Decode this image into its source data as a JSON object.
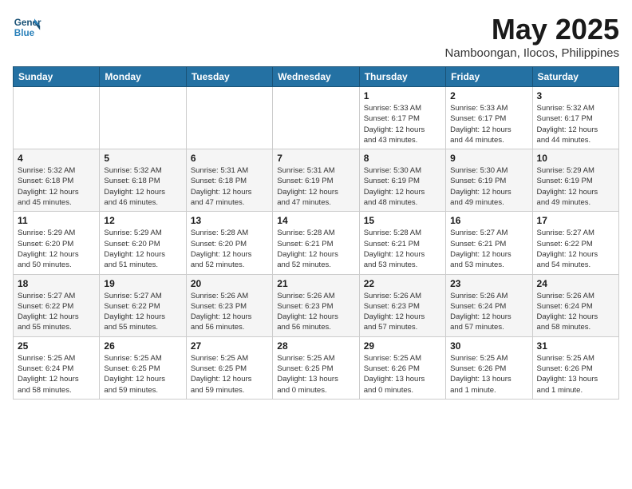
{
  "header": {
    "logo_line1": "General",
    "logo_line2": "Blue",
    "month": "May 2025",
    "location": "Namboongan, Ilocos, Philippines"
  },
  "weekdays": [
    "Sunday",
    "Monday",
    "Tuesday",
    "Wednesday",
    "Thursday",
    "Friday",
    "Saturday"
  ],
  "weeks": [
    [
      {
        "day": "",
        "info": ""
      },
      {
        "day": "",
        "info": ""
      },
      {
        "day": "",
        "info": ""
      },
      {
        "day": "",
        "info": ""
      },
      {
        "day": "1",
        "info": "Sunrise: 5:33 AM\nSunset: 6:17 PM\nDaylight: 12 hours\nand 43 minutes."
      },
      {
        "day": "2",
        "info": "Sunrise: 5:33 AM\nSunset: 6:17 PM\nDaylight: 12 hours\nand 44 minutes."
      },
      {
        "day": "3",
        "info": "Sunrise: 5:32 AM\nSunset: 6:17 PM\nDaylight: 12 hours\nand 44 minutes."
      }
    ],
    [
      {
        "day": "4",
        "info": "Sunrise: 5:32 AM\nSunset: 6:18 PM\nDaylight: 12 hours\nand 45 minutes."
      },
      {
        "day": "5",
        "info": "Sunrise: 5:32 AM\nSunset: 6:18 PM\nDaylight: 12 hours\nand 46 minutes."
      },
      {
        "day": "6",
        "info": "Sunrise: 5:31 AM\nSunset: 6:18 PM\nDaylight: 12 hours\nand 47 minutes."
      },
      {
        "day": "7",
        "info": "Sunrise: 5:31 AM\nSunset: 6:19 PM\nDaylight: 12 hours\nand 47 minutes."
      },
      {
        "day": "8",
        "info": "Sunrise: 5:30 AM\nSunset: 6:19 PM\nDaylight: 12 hours\nand 48 minutes."
      },
      {
        "day": "9",
        "info": "Sunrise: 5:30 AM\nSunset: 6:19 PM\nDaylight: 12 hours\nand 49 minutes."
      },
      {
        "day": "10",
        "info": "Sunrise: 5:29 AM\nSunset: 6:19 PM\nDaylight: 12 hours\nand 49 minutes."
      }
    ],
    [
      {
        "day": "11",
        "info": "Sunrise: 5:29 AM\nSunset: 6:20 PM\nDaylight: 12 hours\nand 50 minutes."
      },
      {
        "day": "12",
        "info": "Sunrise: 5:29 AM\nSunset: 6:20 PM\nDaylight: 12 hours\nand 51 minutes."
      },
      {
        "day": "13",
        "info": "Sunrise: 5:28 AM\nSunset: 6:20 PM\nDaylight: 12 hours\nand 52 minutes."
      },
      {
        "day": "14",
        "info": "Sunrise: 5:28 AM\nSunset: 6:21 PM\nDaylight: 12 hours\nand 52 minutes."
      },
      {
        "day": "15",
        "info": "Sunrise: 5:28 AM\nSunset: 6:21 PM\nDaylight: 12 hours\nand 53 minutes."
      },
      {
        "day": "16",
        "info": "Sunrise: 5:27 AM\nSunset: 6:21 PM\nDaylight: 12 hours\nand 53 minutes."
      },
      {
        "day": "17",
        "info": "Sunrise: 5:27 AM\nSunset: 6:22 PM\nDaylight: 12 hours\nand 54 minutes."
      }
    ],
    [
      {
        "day": "18",
        "info": "Sunrise: 5:27 AM\nSunset: 6:22 PM\nDaylight: 12 hours\nand 55 minutes."
      },
      {
        "day": "19",
        "info": "Sunrise: 5:27 AM\nSunset: 6:22 PM\nDaylight: 12 hours\nand 55 minutes."
      },
      {
        "day": "20",
        "info": "Sunrise: 5:26 AM\nSunset: 6:23 PM\nDaylight: 12 hours\nand 56 minutes."
      },
      {
        "day": "21",
        "info": "Sunrise: 5:26 AM\nSunset: 6:23 PM\nDaylight: 12 hours\nand 56 minutes."
      },
      {
        "day": "22",
        "info": "Sunrise: 5:26 AM\nSunset: 6:23 PM\nDaylight: 12 hours\nand 57 minutes."
      },
      {
        "day": "23",
        "info": "Sunrise: 5:26 AM\nSunset: 6:24 PM\nDaylight: 12 hours\nand 57 minutes."
      },
      {
        "day": "24",
        "info": "Sunrise: 5:26 AM\nSunset: 6:24 PM\nDaylight: 12 hours\nand 58 minutes."
      }
    ],
    [
      {
        "day": "25",
        "info": "Sunrise: 5:25 AM\nSunset: 6:24 PM\nDaylight: 12 hours\nand 58 minutes."
      },
      {
        "day": "26",
        "info": "Sunrise: 5:25 AM\nSunset: 6:25 PM\nDaylight: 12 hours\nand 59 minutes."
      },
      {
        "day": "27",
        "info": "Sunrise: 5:25 AM\nSunset: 6:25 PM\nDaylight: 12 hours\nand 59 minutes."
      },
      {
        "day": "28",
        "info": "Sunrise: 5:25 AM\nSunset: 6:25 PM\nDaylight: 13 hours\nand 0 minutes."
      },
      {
        "day": "29",
        "info": "Sunrise: 5:25 AM\nSunset: 6:26 PM\nDaylight: 13 hours\nand 0 minutes."
      },
      {
        "day": "30",
        "info": "Sunrise: 5:25 AM\nSunset: 6:26 PM\nDaylight: 13 hours\nand 1 minute."
      },
      {
        "day": "31",
        "info": "Sunrise: 5:25 AM\nSunset: 6:26 PM\nDaylight: 13 hours\nand 1 minute."
      }
    ]
  ]
}
